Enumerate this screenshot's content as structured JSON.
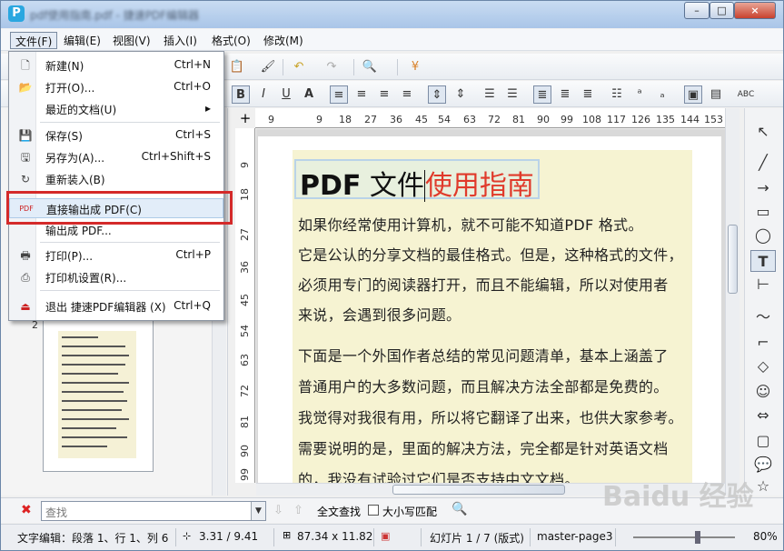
{
  "window": {
    "title": "pdf使用指南.pdf - 捷速PDF编辑器",
    "minimize": "–",
    "maximize": "□",
    "close": "×"
  },
  "menubar": [
    "文件(F)",
    "编辑(E)",
    "视图(V)",
    "插入(I)",
    "格式(O)",
    "修改(M)"
  ],
  "file_menu": {
    "items": [
      {
        "label": "新建(N)",
        "shortcut": "Ctrl+N",
        "icon": "new-file-icon"
      },
      {
        "label": "打开(O)...",
        "shortcut": "Ctrl+O",
        "icon": "open-folder-icon"
      },
      {
        "label": "最近的文档(U)",
        "shortcut": "▸",
        "icon": ""
      },
      {
        "label": "保存(S)",
        "shortcut": "Ctrl+S",
        "icon": "save-icon"
      },
      {
        "label": "另存为(A)...",
        "shortcut": "Ctrl+Shift+S",
        "icon": "save-as-icon"
      },
      {
        "label": "重新装入(B)",
        "shortcut": "",
        "icon": "reload-icon"
      },
      {
        "label": "直接输出成 PDF(C)",
        "shortcut": "",
        "icon": "pdf-export-icon"
      },
      {
        "label": "输出成 PDF...",
        "shortcut": "",
        "icon": ""
      },
      {
        "label": "打印(P)...",
        "shortcut": "Ctrl+P",
        "icon": "print-icon"
      },
      {
        "label": "打印机设置(R)...",
        "shortcut": "",
        "icon": "printer-settings-icon"
      },
      {
        "label": "退出 捷速PDF编辑器 (X)",
        "shortcut": "Ctrl+Q",
        "icon": "exit-icon"
      }
    ]
  },
  "ruler": {
    "h_ticks": [
      "9",
      "9",
      "18",
      "27",
      "36",
      "45",
      "54",
      "63",
      "72",
      "81",
      "90",
      "99",
      "108",
      "117",
      "126",
      "135",
      "144",
      "153"
    ],
    "v_ticks": [
      "9",
      "18",
      "27",
      "36",
      "45",
      "54",
      "63",
      "72",
      "81",
      "90",
      "99"
    ]
  },
  "document": {
    "title_bold": "PDF",
    "title_plain": " 文件",
    "title_red": "使用指南",
    "paragraphs": [
      "如果你经常使用计算机，就不可能不知道PDF 格式。",
      "它是公认的分享文档的最佳格式。但是，这种格式的文件，",
      "必须用专门的阅读器打开，而且不能编辑，所以对使用者",
      "来说，会遇到很多问题。",
      "下面是一个外国作者总结的常见问题清单，基本上涵盖了",
      "普通用户的大多数问题，而且解决方法全部都是免费的。",
      "我觉得对我很有用，所以将它翻译了出来，也供大家参考。",
      "需要说明的是，里面的解决方法，完全都是针对英语文档",
      "的，我没有试验过它们是否支持中文文档。"
    ]
  },
  "thumbnail": {
    "page_number": "2"
  },
  "findbar": {
    "placeholder": "查找",
    "full_text_search": "全文查找",
    "match_case": "大小写匹配"
  },
  "statusbar": {
    "text_edit": "文字编辑：段落 1、行 1、列 6",
    "position": "3.31 / 9.41",
    "size": "87.34 x 11.82",
    "slide": "幻灯片 1 / 7 (版式)",
    "master": "master-page3",
    "zoom": "80%"
  },
  "watermark": "Baidu 经验",
  "colors": {
    "accent_red": "#d42a2a",
    "title_red": "#e03a2b",
    "frame_bg": "#f6f3d2"
  }
}
